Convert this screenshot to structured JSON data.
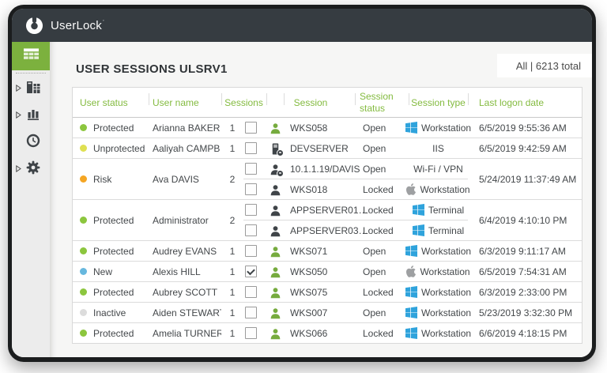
{
  "app": {
    "logo_text": "UserLock",
    "mark": "’"
  },
  "header": {
    "title": "USER SESSIONS ULSRV1",
    "summary": "All | 6213 total"
  },
  "sidebar": {
    "items": [
      {
        "icon": "sessions-grid-icon",
        "active": true,
        "expandable": false
      },
      {
        "icon": "reports-icon",
        "active": false,
        "expandable": true
      },
      {
        "icon": "statistics-icon",
        "active": false,
        "expandable": true
      },
      {
        "icon": "history-clock-icon",
        "active": false,
        "expandable": false
      },
      {
        "icon": "settings-gear-icon",
        "active": false,
        "expandable": true
      }
    ]
  },
  "theme": {
    "brand_green": "#7cb13e",
    "header_text_green": "#84bb40",
    "topbar_gray": "#363c41",
    "windows_blue": "#2fa3dc",
    "apple_gray": "#9ea0a2",
    "status_colors": {
      "green": "#8cc63e",
      "yellow": "#dfe052",
      "orange": "#f5a623",
      "blue": "#67b8de",
      "gray": "#dcdcdc"
    }
  },
  "table": {
    "columns": [
      "User status",
      "User name",
      "Sessions",
      "Session",
      "Session status",
      "Session type",
      "Last logon date"
    ],
    "rows": [
      {
        "user_status": "Protected",
        "status_color": "green",
        "user_name": "Arianna BAKER",
        "session_count": "1",
        "sessions": [
          {
            "checked": false,
            "icon": "user-green",
            "session": "WKS058",
            "status": "Open",
            "type_icon": "windows",
            "type": "Workstation"
          }
        ],
        "last_logon": "6/5/2019 9:55:36 AM"
      },
      {
        "user_status": "Unprotected",
        "status_color": "yellow",
        "user_name": "Aaliyah CAMPB",
        "session_count": "1",
        "sessions": [
          {
            "checked": false,
            "icon": "server-pending",
            "session": "DEVSERVER",
            "status": "Open",
            "type_icon": "none",
            "type": "IIS"
          }
        ],
        "last_logon": "6/5/2019 9:42:59 AM"
      },
      {
        "user_status": "Risk",
        "status_color": "orange",
        "user_name": "Ava DAVIS",
        "session_count": "2",
        "sessions": [
          {
            "checked": false,
            "icon": "user-dark-pending",
            "session": "10.1.1.19/DAVIS",
            "status": "Open",
            "type_icon": "none",
            "type": "Wi-Fi / VPN"
          },
          {
            "checked": false,
            "icon": "user-dark",
            "session": "WKS018",
            "status": "Locked",
            "type_icon": "apple",
            "type": "Workstation"
          }
        ],
        "last_logon": "5/24/2019 11:37:49 AM"
      },
      {
        "user_status": "Protected",
        "status_color": "green",
        "user_name": "Administrator",
        "session_count": "2",
        "sessions": [
          {
            "checked": false,
            "icon": "user-dark",
            "session": "APPSERVER01…",
            "status": "Locked",
            "type_icon": "windows",
            "type": "Terminal"
          },
          {
            "checked": false,
            "icon": "user-dark",
            "session": "APPSERVER03…",
            "status": "Locked",
            "type_icon": "windows",
            "type": "Terminal"
          }
        ],
        "last_logon": "6/4/2019 4:10:10 PM"
      },
      {
        "user_status": "Protected",
        "status_color": "green",
        "user_name": "Audrey EVANS",
        "session_count": "1",
        "sessions": [
          {
            "checked": false,
            "icon": "user-green",
            "session": "WKS071",
            "status": "Open",
            "type_icon": "windows",
            "type": "Workstation"
          }
        ],
        "last_logon": "6/3/2019 9:11:17 AM"
      },
      {
        "user_status": "New",
        "status_color": "blue",
        "user_name": "Alexis HILL",
        "session_count": "1",
        "sessions": [
          {
            "checked": true,
            "icon": "user-green",
            "session": "WKS050",
            "status": "Open",
            "type_icon": "apple",
            "type": "Workstation"
          }
        ],
        "last_logon": "6/5/2019 7:54:31 AM"
      },
      {
        "user_status": "Protected",
        "status_color": "green",
        "user_name": "Aubrey SCOTT",
        "session_count": "1",
        "sessions": [
          {
            "checked": false,
            "icon": "user-green",
            "session": "WKS075",
            "status": "Locked",
            "type_icon": "windows",
            "type": "Workstation"
          }
        ],
        "last_logon": "6/3/2019 2:33:00 PM"
      },
      {
        "user_status": "Inactive",
        "status_color": "gray",
        "user_name": "Aiden STEWART",
        "session_count": "1",
        "sessions": [
          {
            "checked": false,
            "icon": "user-green",
            "session": "WKS007",
            "status": "Open",
            "type_icon": "windows",
            "type": "Workstation"
          }
        ],
        "last_logon": "5/23/2019 3:32:30 PM"
      },
      {
        "user_status": "Protected",
        "status_color": "green",
        "user_name": "Amelia TURNER",
        "session_count": "1",
        "sessions": [
          {
            "checked": false,
            "icon": "user-green",
            "session": "WKS066",
            "status": "Locked",
            "type_icon": "windows",
            "type": "Workstation"
          }
        ],
        "last_logon": "6/6/2019 4:18:15 PM"
      }
    ]
  }
}
